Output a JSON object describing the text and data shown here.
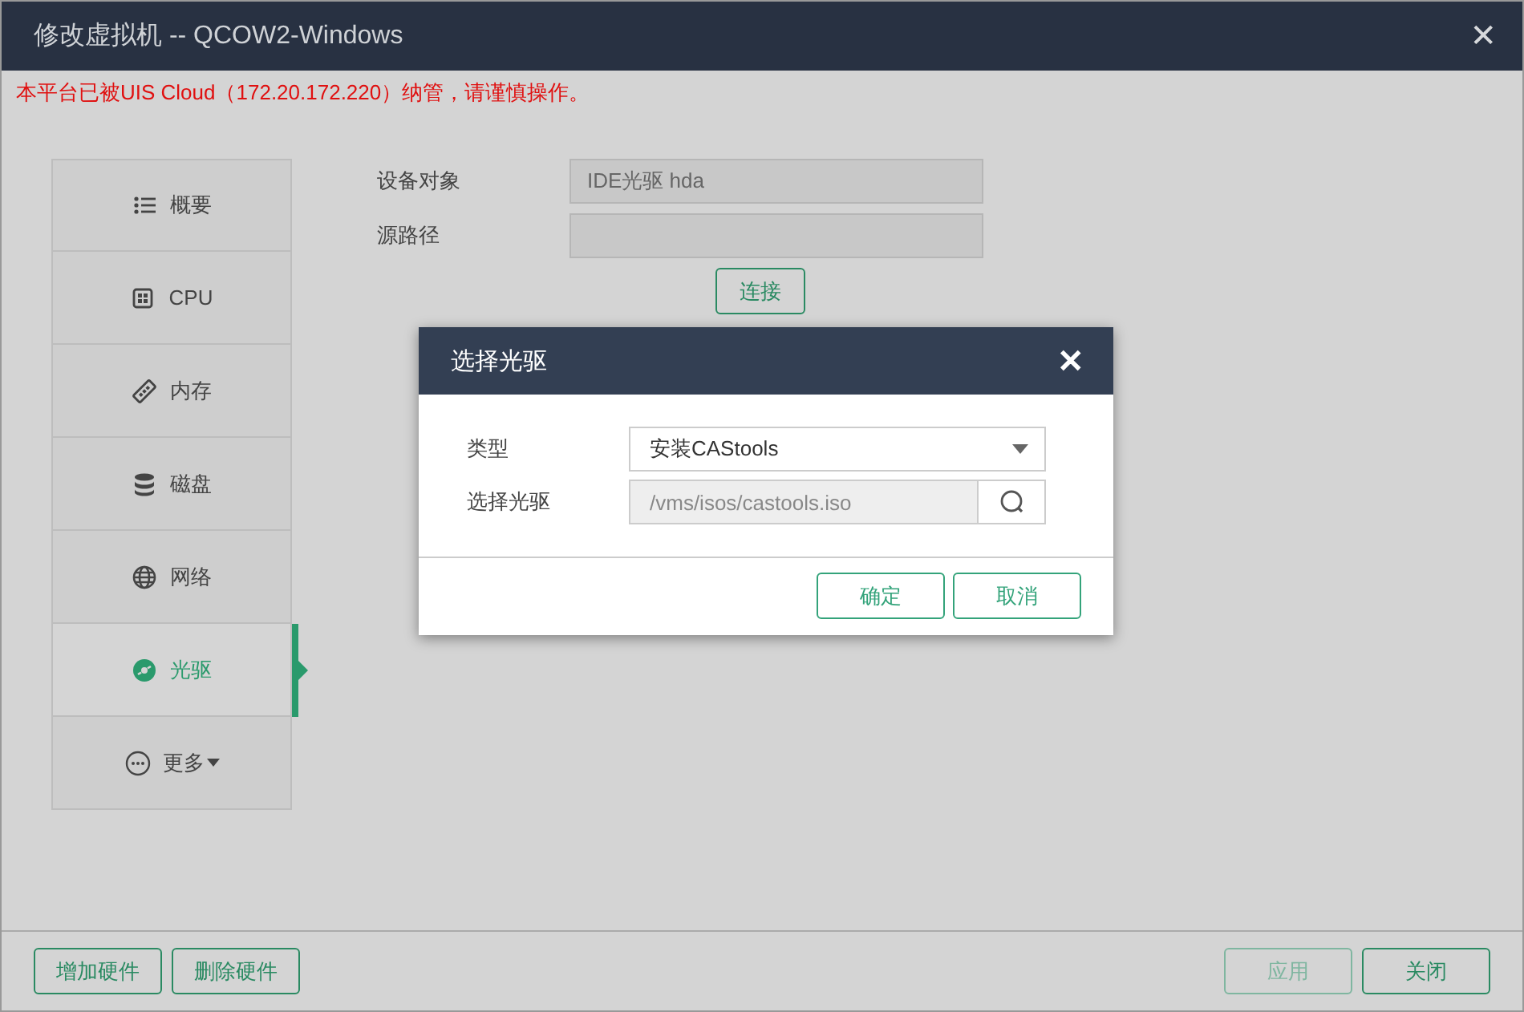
{
  "window": {
    "title": "修改虚拟机 -- QCOW2-Windows",
    "close": "✕",
    "notice": "本平台已被UIS Cloud（172.20.172.220）纳管，请谨慎操作。"
  },
  "sidebar": {
    "items": [
      {
        "kind": "list",
        "label": "概要",
        "selected": false,
        "dropdown": false
      },
      {
        "kind": "chip",
        "label": "CPU",
        "selected": false,
        "dropdown": false
      },
      {
        "kind": "memory",
        "label": "内存",
        "selected": false,
        "dropdown": false
      },
      {
        "kind": "disk",
        "label": "磁盘",
        "selected": false,
        "dropdown": false
      },
      {
        "kind": "globe",
        "label": "网络",
        "selected": false,
        "dropdown": false
      },
      {
        "kind": "cd",
        "label": "光驱",
        "selected": true,
        "dropdown": false
      },
      {
        "kind": "more",
        "label": "更多",
        "selected": false,
        "dropdown": true
      }
    ]
  },
  "form": {
    "fields": [
      {
        "label": "设备对象",
        "value": "IDE光驱 hda"
      },
      {
        "label": "源路径"
      }
    ],
    "connect_button": "连接"
  },
  "dialog": {
    "title": "选择光驱",
    "close": "✕",
    "type_label": "类型",
    "type_value": "安装CAStools",
    "drive_label": "选择光驱",
    "drive_value": "/vms/isos/castools.iso",
    "buttons": [
      "确定",
      "取消"
    ]
  },
  "footer": {
    "left_buttons": [
      {
        "label": "增加硬件",
        "disabled": false
      },
      {
        "label": "删除硬件",
        "disabled": false
      }
    ],
    "right_buttons": [
      {
        "label": "应用",
        "disabled": true
      },
      {
        "label": "关闭",
        "disabled": false
      }
    ]
  }
}
